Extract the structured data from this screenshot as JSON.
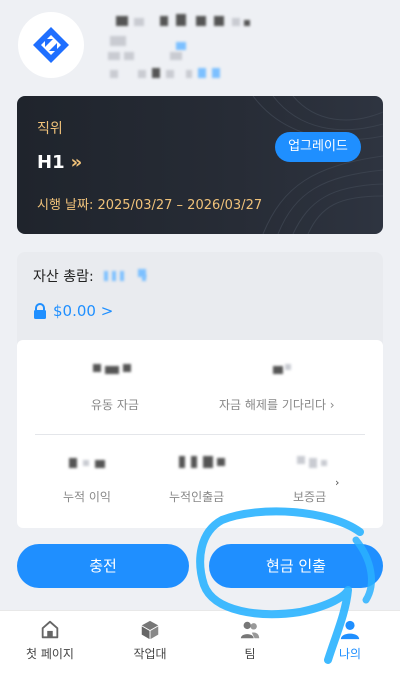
{
  "vip_card": {
    "rank_label": "직위",
    "rank_value": "H1",
    "rank_chevron": "»",
    "date_range": "시행 날짜: 2025/03/27 – 2026/03/27",
    "upgrade_label": "업그레이드"
  },
  "assets": {
    "title": "자산 총람:",
    "amount": "$0.00 >",
    "stats": [
      {
        "label": "유동 자금"
      },
      {
        "label": "자금 해제를 기다리다 ›"
      },
      {
        "label": "누적 이익"
      },
      {
        "label": "누적인출금"
      },
      {
        "label": "보증금"
      }
    ]
  },
  "actions": {
    "deposit_label": "충전",
    "withdraw_label": "현금 인출"
  },
  "tabbar": {
    "items": [
      {
        "label": "첫 페이지",
        "icon": "home-icon"
      },
      {
        "label": "작업대",
        "icon": "box-icon"
      },
      {
        "label": "팀",
        "icon": "team-icon"
      },
      {
        "label": "나의",
        "icon": "user-icon"
      }
    ],
    "active_color": "#1f8fff"
  },
  "colors": {
    "accent": "#1f8fff",
    "gold": "#f0c27a",
    "card_dark": "#232830"
  }
}
